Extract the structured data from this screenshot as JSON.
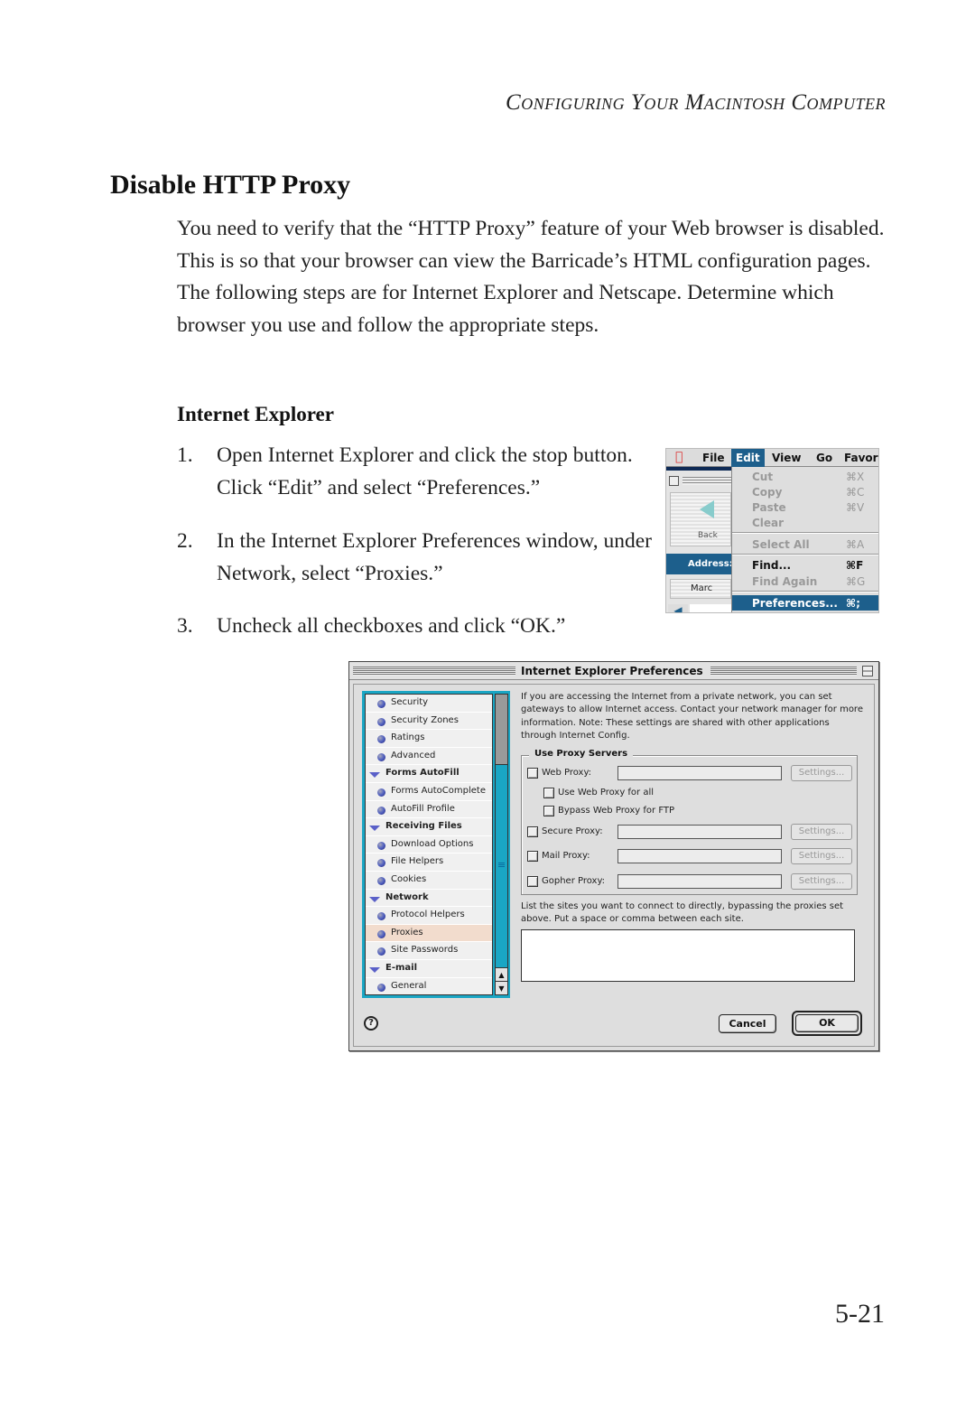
{
  "running_head": "Configuring Your Macintosh Computer",
  "section_title": "Disable HTTP Proxy",
  "intro": "You need to verify that the “HTTP Proxy” feature of your Web browser is disabled. This is so that your browser can view the Barricade’s HTML configuration pages. The following steps are for Internet Explorer and Netscape. Determine which browser you use and follow the appropriate steps.",
  "subhead": "Internet Explorer",
  "steps": [
    {
      "num": "1.",
      "text": "Open Internet Explorer and click the stop button. Click “Edit” and select “Preferences.”"
    },
    {
      "num": "2.",
      "text": "In the Internet Explorer Preferences window, under Network, select “Proxies.”"
    },
    {
      "num": "3.",
      "text": "Uncheck all checkboxes and click “OK.”"
    }
  ],
  "page_number": "5-21",
  "edit_menu_screenshot": {
    "apple_icon": "apple-logo-icon",
    "menubar": [
      "File",
      "Edit",
      "View",
      "Go",
      "Favor"
    ],
    "active_menu": "Edit",
    "browser": {
      "back_label": "Back",
      "address_label": "Address:",
      "favorite_label": "Marc"
    },
    "items": [
      {
        "label": "Cut",
        "shortcut": "⌘X",
        "enabled": false
      },
      {
        "label": "Copy",
        "shortcut": "⌘C",
        "enabled": false
      },
      {
        "label": "Paste",
        "shortcut": "⌘V",
        "enabled": false
      },
      {
        "label": "Clear",
        "shortcut": "",
        "enabled": false
      },
      {
        "label": "Select All",
        "shortcut": "⌘A",
        "enabled": false
      },
      {
        "label": "Find...",
        "shortcut": "⌘F",
        "enabled": true
      },
      {
        "label": "Find Again",
        "shortcut": "⌘G",
        "enabled": false
      },
      {
        "label": "Preferences...",
        "shortcut": "⌘;",
        "enabled": true,
        "selected": true
      }
    ]
  },
  "prefs_window": {
    "title": "Internet Explorer Preferences",
    "sidebar": [
      {
        "label": "Security",
        "type": "item"
      },
      {
        "label": "Security Zones",
        "type": "item"
      },
      {
        "label": "Ratings",
        "type": "item"
      },
      {
        "label": "Advanced",
        "type": "item"
      },
      {
        "label": "Forms AutoFill",
        "type": "group"
      },
      {
        "label": "Forms AutoComplete",
        "type": "item"
      },
      {
        "label": "AutoFill Profile",
        "type": "item"
      },
      {
        "label": "Receiving Files",
        "type": "group"
      },
      {
        "label": "Download Options",
        "type": "item"
      },
      {
        "label": "File Helpers",
        "type": "item"
      },
      {
        "label": "Cookies",
        "type": "item"
      },
      {
        "label": "Network",
        "type": "group"
      },
      {
        "label": "Protocol Helpers",
        "type": "item"
      },
      {
        "label": "Proxies",
        "type": "item",
        "selected": true
      },
      {
        "label": "Site Passwords",
        "type": "item"
      },
      {
        "label": "E-mail",
        "type": "group"
      },
      {
        "label": "General",
        "type": "item"
      }
    ],
    "description": "If you are accessing the Internet from a private network, you can set gateways to allow Internet access. Contact your network manager for more information. Note: These settings are shared with other applications through Internet Config.",
    "group_label": "Use Proxy Servers",
    "proxies": {
      "web": {
        "label": "Web Proxy:",
        "value": "",
        "checked": false,
        "settings": "Settings..."
      },
      "use_for_all": {
        "label": "Use Web Proxy for all",
        "checked": false
      },
      "bypass_ftp": {
        "label": "Bypass Web Proxy for FTP",
        "checked": false
      },
      "secure": {
        "label": "Secure Proxy:",
        "value": "",
        "checked": false,
        "settings": "Settings..."
      },
      "mail": {
        "label": "Mail Proxy:",
        "value": "",
        "checked": false,
        "settings": "Settings..."
      },
      "gopher": {
        "label": "Gopher Proxy:",
        "value": "",
        "checked": false,
        "settings": "Settings..."
      }
    },
    "bypass_description": "List the sites you want to connect to directly, bypassing the proxies set above. Put a space or comma between each site.",
    "bypass_value": "",
    "help_icon": "?",
    "cancel_label": "Cancel",
    "ok_label": "OK"
  }
}
